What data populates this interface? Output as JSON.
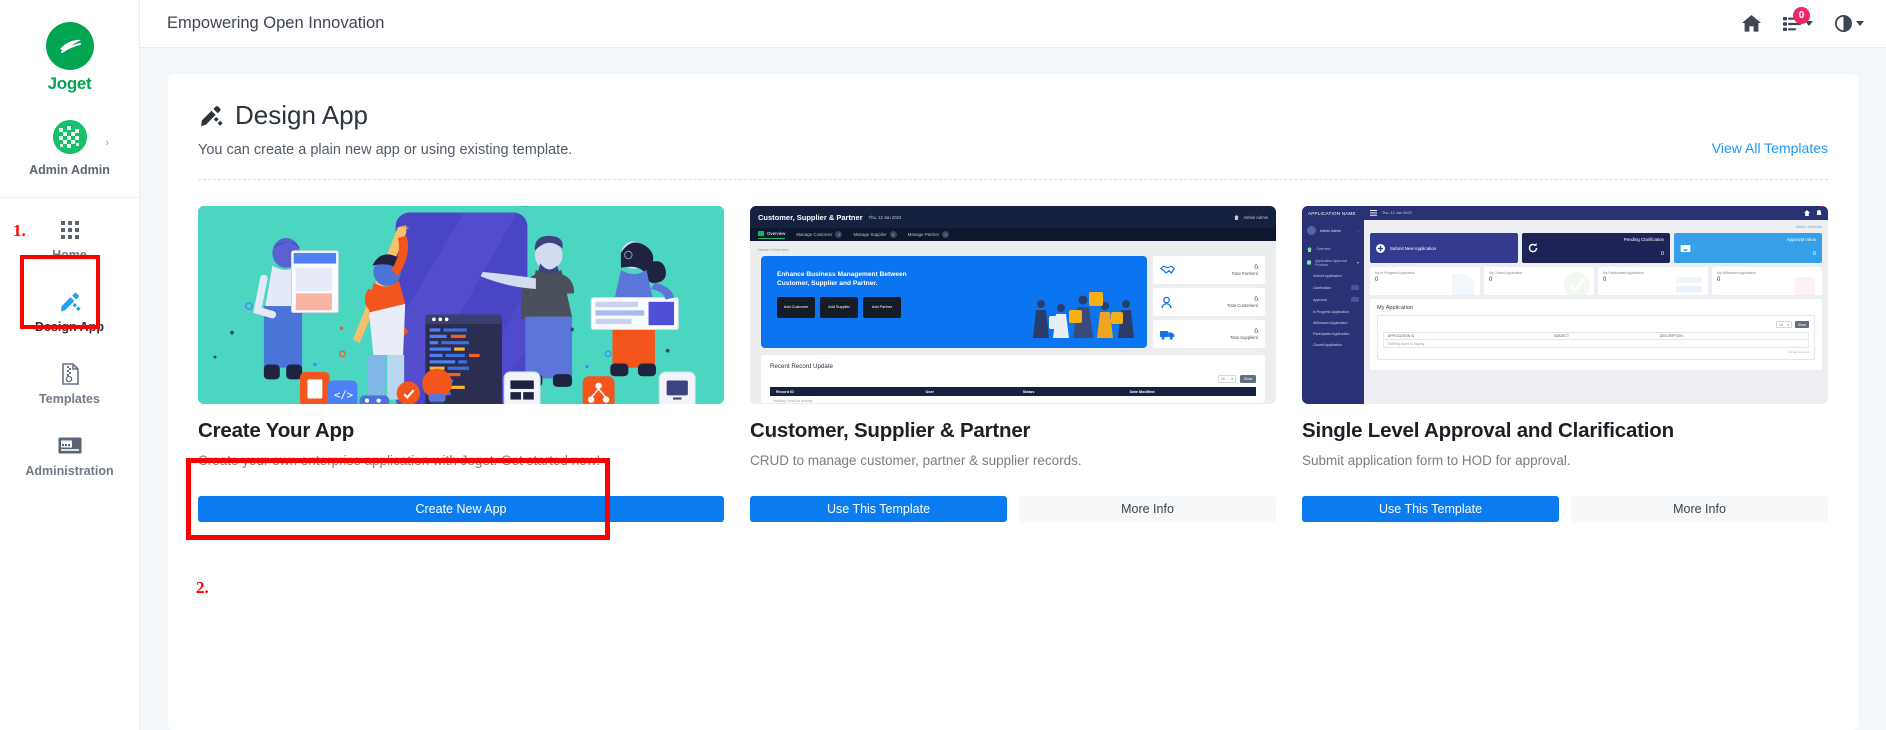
{
  "brand": {
    "name": "Joget"
  },
  "sidebar": {
    "profile": {
      "name": "Admin Admin",
      "chevron": "chevron-right-icon"
    },
    "items": [
      {
        "label": "Home",
        "icon": "grid-apps-icon",
        "active": false
      },
      {
        "label": "Design App",
        "icon": "pencil-ruler-icon",
        "active": true
      },
      {
        "label": "Templates",
        "icon": "file-archive-icon",
        "active": false
      },
      {
        "label": "Administration",
        "icon": "id-card-icon",
        "active": false
      }
    ]
  },
  "annotations": {
    "step1": "1.",
    "step2": "2."
  },
  "topbar": {
    "title": "Empowering Open Innovation",
    "home_icon": "home-icon",
    "inbox_icon": "inbox-list-icon",
    "inbox_badge": "0",
    "theme_icon": "contrast-icon"
  },
  "panel": {
    "icon": "pencil-ruler-icon",
    "title": "Design App",
    "subtitle": "You can create a plain new app or using existing template.",
    "view_all": "View All Templates"
  },
  "cards": [
    {
      "thumb_type": "illustration",
      "title": "Create Your App",
      "desc": "Create your own enterprise application with Joget. Get started now!",
      "primary_label": "Create New App",
      "secondary_label": null
    },
    {
      "thumb_type": "screenshot-csp",
      "title": "Customer, Supplier & Partner",
      "desc": "CRUD to manage customer, partner & supplier records.",
      "primary_label": "Use This Template",
      "secondary_label": "More Info"
    },
    {
      "thumb_type": "screenshot-approval",
      "title": "Single Level Approval and Clarification",
      "desc": "Submit application form to HOD for approval.",
      "primary_label": "Use This Template",
      "secondary_label": "More Info"
    }
  ],
  "thumb_csp": {
    "app_name": "Customer, Supplier & Partner",
    "date": "Thu, 12 Jan 2023",
    "user": "Admin Admin",
    "tabs": [
      {
        "label": "Overview",
        "badge": null
      },
      {
        "label": "Manage Customer",
        "badge": "0"
      },
      {
        "label": "Manage Supplier",
        "badge": "0"
      },
      {
        "label": "Manage Partner",
        "badge": "0"
      }
    ],
    "breadcrumb": "Home / Overview",
    "hero_line1": "Enhance Business Management Between",
    "hero_line2": "Customer, Supplier and Partner.",
    "hero_buttons": [
      "Add Customer",
      "Add Supplier",
      "Add Partner"
    ],
    "stats": [
      {
        "value": "0",
        "label": "Total Partners",
        "icon": "handshake-icon"
      },
      {
        "value": "0",
        "label": "Total Customers",
        "icon": "user-icon"
      },
      {
        "value": "0",
        "label": "Total Suppliers",
        "icon": "truck-icon"
      }
    ],
    "table_title": "Recent Record Update",
    "page_size": "10",
    "show_label": "Show",
    "columns": [
      "Record ID",
      "User",
      "Status",
      "Date Modified"
    ],
    "empty": "Nothing found to display."
  },
  "thumb_approval": {
    "app_name": "APPLICATION NAME",
    "date": "Thu, 12 Jan 2023",
    "user": "Admin Admin",
    "badge": "0",
    "breadcrumb": "Home  /  Overview",
    "menu": [
      {
        "label": "Overview",
        "sub": false,
        "badge": false
      },
      {
        "label": "Application Approval Process",
        "sub": false,
        "badge": false
      },
      {
        "label": "Submit Application",
        "sub": true,
        "badge": false
      },
      {
        "label": "Clarification",
        "sub": true,
        "badge": true
      },
      {
        "label": "Approval",
        "sub": true,
        "badge": true
      },
      {
        "label": "In Progress Application",
        "sub": true,
        "badge": false
      },
      {
        "label": "Withdrawn Application",
        "sub": true,
        "badge": false
      },
      {
        "label": "Participated Application",
        "sub": true,
        "badge": false
      },
      {
        "label": "Closed Application",
        "sub": true,
        "badge": false
      }
    ],
    "tiles": [
      {
        "label": "Submit New Application",
        "value": null,
        "style": "a",
        "icon": "plus-circle-icon"
      },
      {
        "label": "Pending Clarification",
        "value": "0",
        "style": "b",
        "icon": "refresh-icon"
      },
      {
        "label": "Approval Inbox",
        "value": "0",
        "style": "c",
        "icon": "inbox-icon"
      }
    ],
    "kpis": [
      {
        "label": "My In Progress Application",
        "value": "0"
      },
      {
        "label": "My Closed Application",
        "value": "0"
      },
      {
        "label": "My Participated Application",
        "value": "0"
      },
      {
        "label": "My Withdrawn Application",
        "value": "0"
      }
    ],
    "table_title": "My Application",
    "page_size": "10",
    "show_label": "Show",
    "columns": [
      "APPLICATION ID",
      "SUBJECT",
      "DESCRIPTION"
    ],
    "empty": "Nothing found to display.",
    "footer": "No items found"
  },
  "colors": {
    "brand_green": "#00a551",
    "accent_blue": "#0b7bf0",
    "link_blue": "#2196f3",
    "badge_pink": "#f0266b",
    "annotation_red": "#ff0000",
    "illustration_bg": "#4ad6c0"
  }
}
